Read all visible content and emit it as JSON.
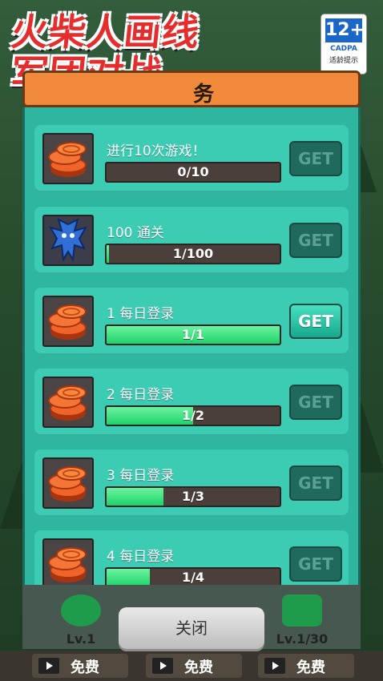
{
  "game": {
    "title_line1": "火柴人画线",
    "title_line2": "军团对战",
    "panel_title": "务"
  },
  "rating": {
    "age": "12+",
    "org": "CADPA",
    "hint": "适龄提示"
  },
  "tasks": [
    {
      "label": "进行10次游戏！",
      "progress_text": "0/10",
      "progress": 0.0,
      "button": "GET",
      "enabled": false,
      "icon": "coins-icon"
    },
    {
      "label": "100 通关",
      "progress_text": "1/100",
      "progress": 0.01,
      "button": "GET",
      "enabled": false,
      "icon": "monster-avatar-icon"
    },
    {
      "label": "1 每日登录",
      "progress_text": "1/1",
      "progress": 1.0,
      "button": "GET",
      "enabled": true,
      "icon": "coins-icon"
    },
    {
      "label": "2 每日登录",
      "progress_text": "1/2",
      "progress": 0.5,
      "button": "GET",
      "enabled": false,
      "icon": "coins-icon"
    },
    {
      "label": "3 每日登录",
      "progress_text": "1/3",
      "progress": 0.33,
      "button": "GET",
      "enabled": false,
      "icon": "coins-icon"
    },
    {
      "label": "4 每日登录",
      "progress_text": "1/4",
      "progress": 0.25,
      "button": "GET",
      "enabled": false,
      "icon": "coins-icon"
    }
  ],
  "bottom": {
    "close_label": "关闭",
    "upgrade_left_level": "Lv.1",
    "upgrade_right_level": "Lv.1/30",
    "free_label": "免费"
  },
  "colors": {
    "panel": "#2fb6a0",
    "header": "#f08a3a",
    "progress_fill": "#1ed36a"
  }
}
